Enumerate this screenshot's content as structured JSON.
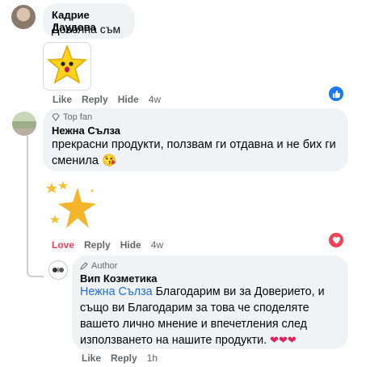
{
  "colors": {
    "link": "#216fdb",
    "love": "#f33e58",
    "meta_gray": "#65676b",
    "bubble": "#f0f2f5",
    "like_blue": "#1877f2"
  },
  "comments": [
    {
      "author": "Кадрие Даудова",
      "text": "Доволна съм",
      "sticker": "star-sticker",
      "actions": {
        "like": "Like",
        "reply": "Reply",
        "hide": "Hide",
        "time": "4w"
      },
      "reaction": "like-reaction-icon"
    },
    {
      "badge": "Top fan",
      "author": "Нежна Сълза",
      "text": "прекрасни продукти, ползвам ги отдавна и не бих ги сменила",
      "emoji": "😘",
      "sticker": "sparkle-star-sticker",
      "actions": {
        "like": "Love",
        "reply": "Reply",
        "hide": "Hide",
        "time": "4w"
      },
      "reaction": "love-reaction-icon"
    },
    {
      "badge": "Author",
      "author": "Вип Козметика",
      "mention": "Нежна Сълза",
      "text": " Благодарим ви за Доверието, и също ви Благодарим за това че споделяте вашето лично мнение и впечетления след използването на нашите продукти. ",
      "hearts": "❤❤❤",
      "actions": {
        "like": "Like",
        "reply": "Reply",
        "time": "1h"
      }
    }
  ]
}
